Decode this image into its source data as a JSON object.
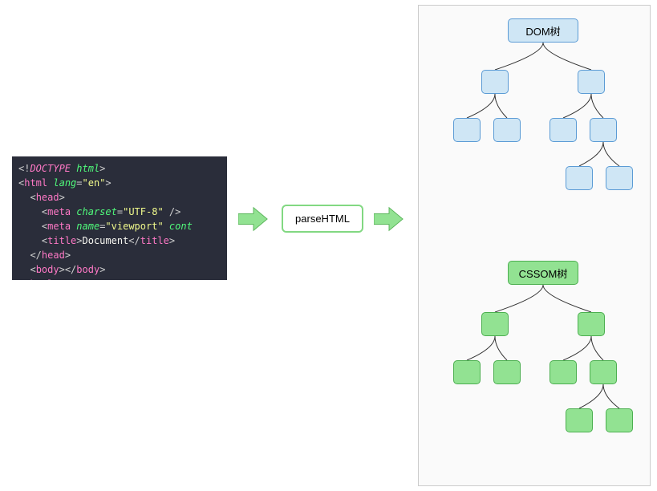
{
  "code": {
    "line1_doctype": "DOCTYPE",
    "line1_html": "html",
    "line2_html": "html",
    "line2_lang": "lang",
    "line2_langval": "\"en\"",
    "line3_head": "head",
    "line4_meta": "meta",
    "line4_charset": "charset",
    "line4_charsetval": "\"UTF-8\"",
    "line5_meta": "meta",
    "line5_name": "name",
    "line5_nameval": "\"viewport\"",
    "line5_cont": "cont",
    "line6_title": "title",
    "line6_text": "Document",
    "line7_head": "head",
    "line8_body": "body",
    "line9_html": "html"
  },
  "parse_label": "parseHTML",
  "dom_label": "DOM树",
  "cssom_label": "CSSOM树"
}
